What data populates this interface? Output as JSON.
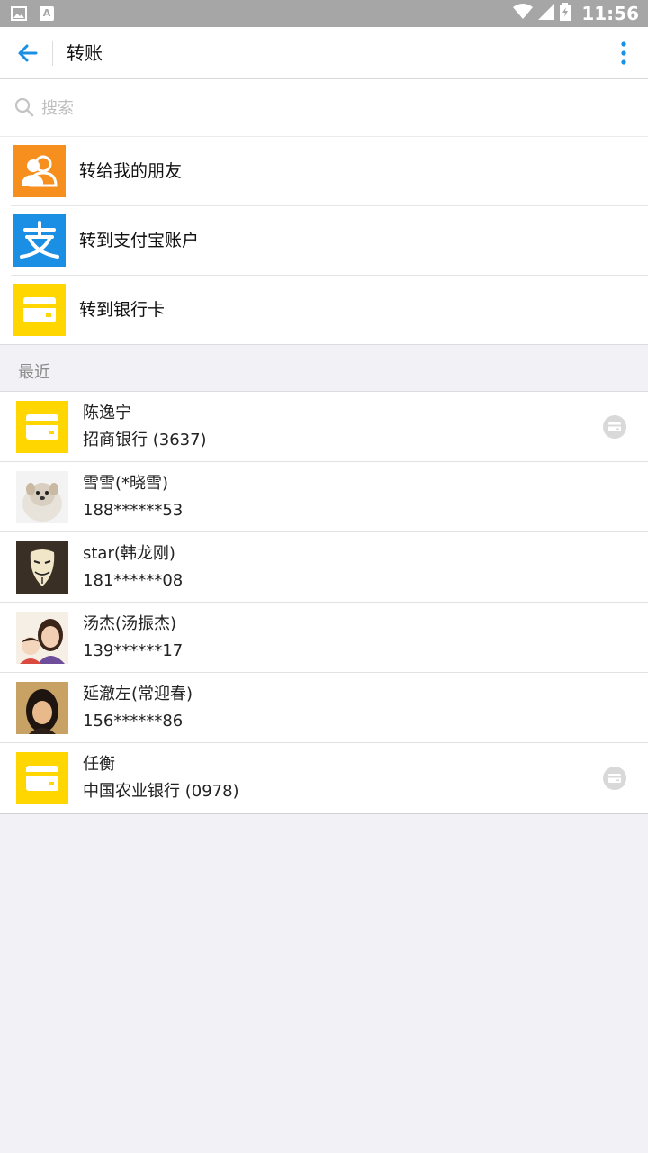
{
  "status_bar": {
    "time": "11:56",
    "notif_a_letter": "A"
  },
  "app_bar": {
    "title": "转账"
  },
  "search": {
    "placeholder": "搜索"
  },
  "options": [
    {
      "label": "转给我的朋友",
      "icon": "friends-icon",
      "color": "#f78f1e"
    },
    {
      "label": "转到支付宝账户",
      "icon": "alipay-icon",
      "color": "#1a8fe3"
    },
    {
      "label": "转到银行卡",
      "icon": "bank-card-icon",
      "color": "#ffd600"
    }
  ],
  "recent": {
    "title": "最近",
    "items": [
      {
        "name": "陈逸宁",
        "detail": "招商银行 (3637)",
        "avatar": "bank-card-icon",
        "has_card_badge": true
      },
      {
        "name": "雪雪(*晓雪)",
        "detail": "188******53",
        "avatar": "photo-avatar"
      },
      {
        "name": "star(韩龙刚)",
        "detail": "181******08",
        "avatar": "mask-avatar"
      },
      {
        "name": "汤杰(汤振杰)",
        "detail": "139******17",
        "avatar": "photo-avatar"
      },
      {
        "name": "延澈左(常迎春)",
        "detail": "156******86",
        "avatar": "photo-avatar"
      },
      {
        "name": "任衡",
        "detail": "中国农业银行 (0978)",
        "avatar": "bank-card-icon",
        "has_card_badge": true
      }
    ]
  },
  "colors": {
    "accent": "#1a8fe3",
    "card_yellow": "#ffd600",
    "friend_orange": "#f78f1e",
    "background": "#f2f2f6"
  }
}
